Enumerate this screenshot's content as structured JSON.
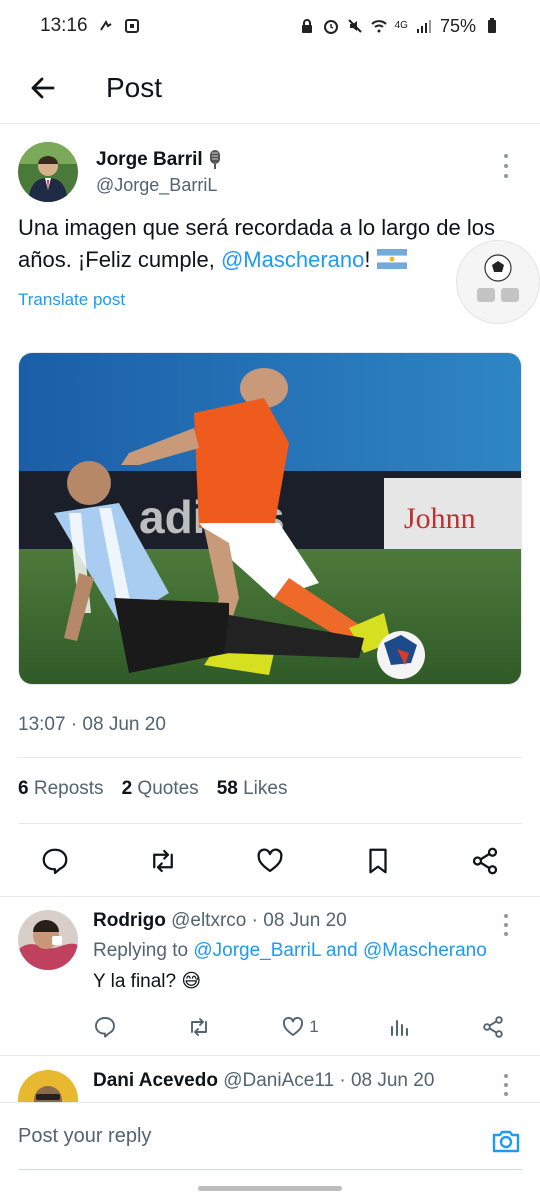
{
  "status_bar": {
    "time": "13:16",
    "battery": "75%",
    "network": "4G"
  },
  "header": {
    "title": "Post"
  },
  "tweet": {
    "author_name": "Jorge Barril",
    "author_handle": "@Jorge_BarriL",
    "text_before": "Una imagen que será recordada a lo largo de los años. ¡Feliz cumple, ",
    "mention": "@Mascherano",
    "text_after": "! ",
    "translate_label": "Translate post",
    "timestamp": "13:07 · 08 Jun 20",
    "stats": {
      "reposts_count": "6",
      "reposts_label": "Reposts",
      "quotes_count": "2",
      "quotes_label": "Quotes",
      "likes_count": "58",
      "likes_label": "Likes"
    }
  },
  "replies": [
    {
      "name": "Rodrigo",
      "handle": "@eltxrco",
      "date": "· 08 Jun 20",
      "replying_prefix": "Replying to ",
      "replying_users": "@Jorge_BarriL and @Mascherano",
      "text": "Y la final? 😅",
      "like_count": "1"
    },
    {
      "name": "Dani Acevedo",
      "handle": "@DaniAce11",
      "date": "· 08 Jun 20"
    }
  ],
  "composer": {
    "placeholder": "Post your reply"
  },
  "colors": {
    "accent": "#1d9bf0",
    "secondary_text": "#536471",
    "primary_text": "#0f1419"
  }
}
